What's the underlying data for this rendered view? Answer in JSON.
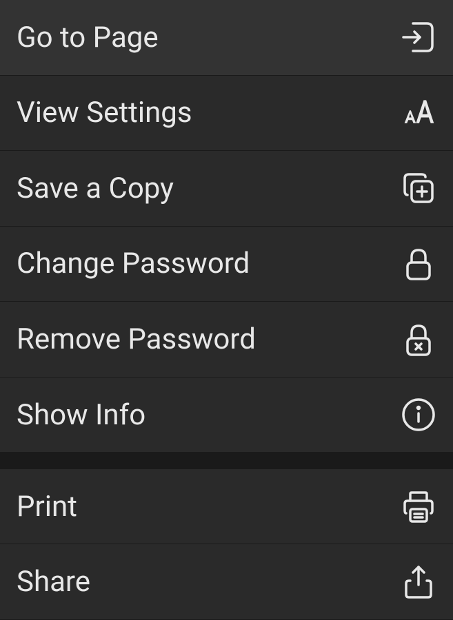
{
  "menu": {
    "items": [
      {
        "label": "Go to Page",
        "icon": "go-to-page-icon"
      },
      {
        "label": "View Settings",
        "icon": "text-size-icon"
      },
      {
        "label": "Save a Copy",
        "icon": "copy-plus-icon"
      },
      {
        "label": "Change Password",
        "icon": "lock-icon"
      },
      {
        "label": "Remove Password",
        "icon": "lock-remove-icon"
      },
      {
        "label": "Show Info",
        "icon": "info-icon"
      },
      {
        "label": "Print",
        "icon": "print-icon"
      },
      {
        "label": "Share",
        "icon": "share-icon"
      }
    ]
  }
}
